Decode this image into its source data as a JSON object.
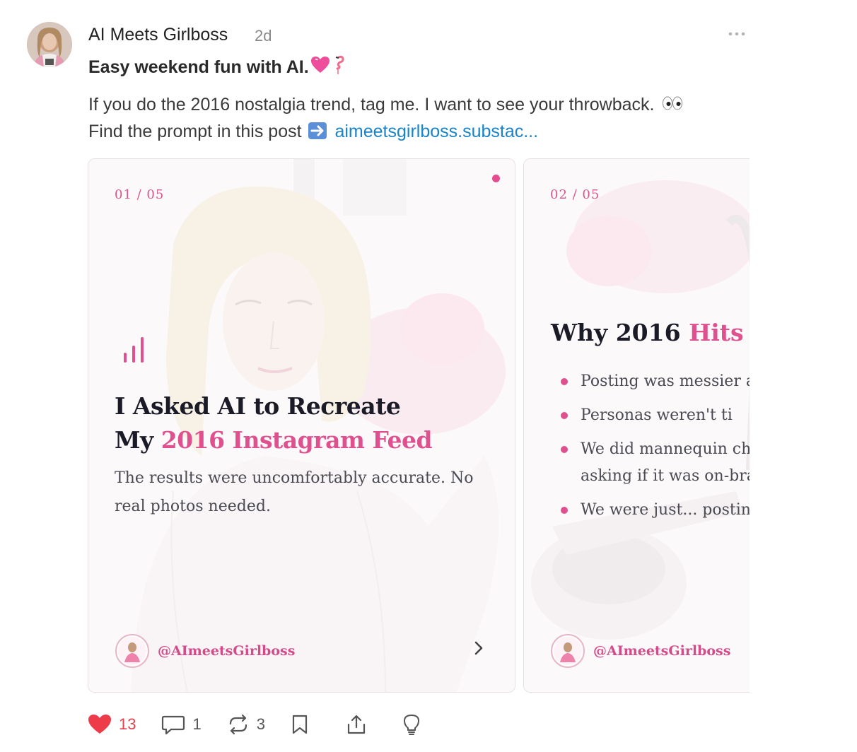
{
  "post": {
    "author": "AI Meets Girlboss",
    "time": "2d",
    "headline": "Easy weekend fun with AI.",
    "body_line1": "If you do the 2016 nostalgia trend, tag me. I want to see your throwback.",
    "body_line2_prefix": "Find the prompt in this post",
    "link_text": "aimeetsgirlboss.substac..."
  },
  "carousel": {
    "slides": [
      {
        "number": "01 / 05",
        "title_line1": "I Asked AI to Recreate",
        "title_line2_plain": "My ",
        "title_line2_highlight": "2016 Instagram Feed",
        "subtitle": "The results were uncomfortably accurate. No real photos needed.",
        "handle": "@AImeetsGirlboss"
      },
      {
        "number": "02 / 05",
        "title_plain": "Why 2016 ",
        "title_highlight": "Hits Di",
        "bullets": [
          "Posting was messier a",
          "Personas weren't  ti",
          "We did mannequin ch",
          "asking if it was on-bra",
          "We were just... posting"
        ],
        "handle": "@AImeetsGirlboss"
      }
    ]
  },
  "actions": {
    "likes": "13",
    "comments": "1",
    "restacks": "3"
  },
  "colors": {
    "accent_pink": "#e0508f",
    "link_blue": "#1a83c9",
    "like_red": "#e0414f"
  },
  "icons": [
    "more-icon",
    "heart-emoji",
    "flamingo-emoji",
    "eyes-emoji",
    "right-arrow-emoji",
    "heart-icon",
    "comment-icon",
    "restack-icon",
    "bookmark-icon",
    "share-icon",
    "lightbulb-icon",
    "chevron-right-icon",
    "bar-chart-icon"
  ]
}
